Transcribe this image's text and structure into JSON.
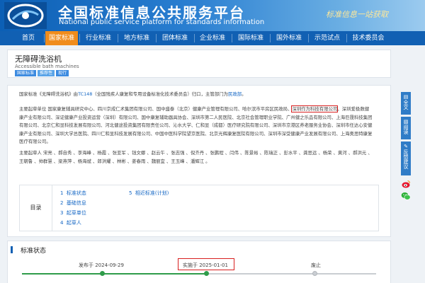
{
  "header": {
    "title_cn": "全国标准信息公共服务平台",
    "title_en": "National public service platform  for standards information",
    "slogan": "标准信息一站获取"
  },
  "nav": {
    "items": [
      {
        "label": "首页",
        "active": false
      },
      {
        "label": "国家标准",
        "active": true
      },
      {
        "label": "行业标准",
        "active": false
      },
      {
        "label": "地方标准",
        "active": false
      },
      {
        "label": "团体标准",
        "active": false
      },
      {
        "label": "企业标准",
        "active": false
      },
      {
        "label": "国际标准",
        "active": false
      },
      {
        "label": "国外标准",
        "active": false
      },
      {
        "label": "示范试点",
        "active": false
      },
      {
        "label": "技术委员会",
        "active": false
      }
    ]
  },
  "standard": {
    "title": "无障碍洗浴机",
    "subtitle": "Accessible bath machines",
    "tags": [
      "国家标准",
      "推荐性",
      "现行"
    ]
  },
  "content": {
    "intro_prefix": "国家标准《无障碍洗浴机》由",
    "intro_tc": "TC148",
    "intro_mid": "（全国残疾人康复和专用设备标准化技术委员会）归口，主管部门为",
    "intro_dept": "民政部",
    "intro_suffix": "。",
    "units_before": "主要起草单位 国家康复辅具研究中心、四川京成仁术集团有限公司、国中盛泰（北京）健康产业管理有限公司、哈尔滨市平房区民政局、",
    "units_highlight": "深圳作为科技有限公司",
    "units_after": "、深圳爱极数健康产业有限公司、深证健康产业投资运营（深圳）有限公司、国中康复辅助器具协会、深圳市第二人民医院、北京社会管理职业学院、广州健之乐品有限公司、上海巨晟科技集团有限公司、北京仁和显科技发展有限公司、河北健途投资集团有限责任公司、沁水大学、仁和显（成都）医疗研究院有限公司、深圳市京港区养老服务业协会、深圳市任达心安健康产业有限公司、深圳大学总医院、四川仁和显科技发展有限公司、中国中医科学院望京医院、北京光辉康复医院有限公司、深圳市深受健康产业发展有限公司、上海奥思特康复医疗有限公司。",
    "drafters": "主要起草人 宋亮 、郝自秀 、李海峰 、杨霞 、张亚军 、钱文娜 、赵云午 、张志强 、倪齐丹 、张鹏程 、闫伟 、陈景裕 、陈瑞正 、彭水平 、龚思远 、杨荣 、黄河 、郝洪元 、王朝鲁 、帅群慧 、梁燕萍 、杨海斌 、郎洪耀 、林彬 、姜春雨 、魏丽宜 、王玉峰 、潘辉江 。"
  },
  "toc": {
    "label": "目录",
    "items": [
      {
        "num": "1",
        "label": "标准状态"
      },
      {
        "num": "2",
        "label": "基础信息"
      },
      {
        "num": "3",
        "label": "起草单位"
      },
      {
        "num": "4",
        "label": "起草人"
      },
      {
        "num": "5",
        "label": "相近标准(计划)"
      }
    ]
  },
  "status": {
    "heading": "标准状态",
    "published": "发布于 2024-09-29",
    "implemented": "实施于 2025-01-01",
    "abolished": "废止"
  },
  "side_tools": [
    {
      "label": "全文",
      "icon": "document-icon"
    },
    {
      "label": "阅读",
      "icon": "book-icon"
    },
    {
      "label": "反馈建议",
      "icon": "feedback-icon"
    }
  ],
  "share_icons": [
    "weibo-icon",
    "wechat-icon"
  ],
  "colors": {
    "header_blue": "#0c5fb5",
    "nav_blue": "#1160b3",
    "nav_active": "#f08c1c",
    "link_blue": "#1366c4",
    "highlight_red": "#d81f1f",
    "timeline_green": "#2f9c4a"
  }
}
